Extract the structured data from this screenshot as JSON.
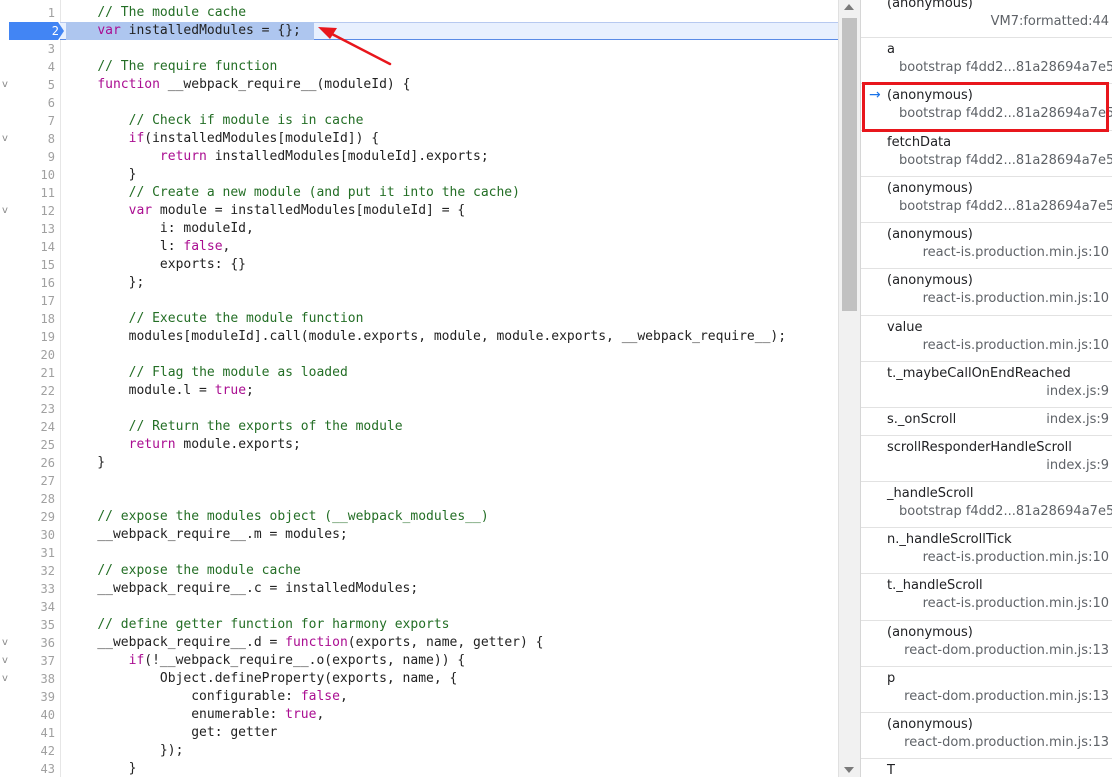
{
  "editor": {
    "current_line": "2",
    "lines": [
      {
        "n": "1",
        "fold": "",
        "segs": [
          [
            "    ",
            ""
          ],
          [
            "// The module cache",
            "c"
          ]
        ]
      },
      {
        "n": "2",
        "fold": "",
        "segs": [
          [
            "    ",
            ""
          ],
          [
            "var",
            "k"
          ],
          [
            " installedModules = {};",
            ""
          ]
        ]
      },
      {
        "n": "3",
        "fold": "",
        "segs": []
      },
      {
        "n": "4",
        "fold": "",
        "segs": [
          [
            "    ",
            ""
          ],
          [
            "// The require function",
            "c"
          ]
        ]
      },
      {
        "n": "5",
        "fold": "v",
        "segs": [
          [
            "    ",
            ""
          ],
          [
            "function",
            "k"
          ],
          [
            " __webpack_require__(moduleId) {",
            ""
          ]
        ]
      },
      {
        "n": "6",
        "fold": "",
        "segs": []
      },
      {
        "n": "7",
        "fold": "",
        "segs": [
          [
            "        ",
            ""
          ],
          [
            "// Check if module is in cache",
            "c"
          ]
        ]
      },
      {
        "n": "8",
        "fold": "v",
        "segs": [
          [
            "        ",
            ""
          ],
          [
            "if",
            "k"
          ],
          [
            "(installedModules[moduleId]) {",
            ""
          ]
        ]
      },
      {
        "n": "9",
        "fold": "",
        "segs": [
          [
            "            ",
            ""
          ],
          [
            "return",
            "k"
          ],
          [
            " installedModules[moduleId].exports;",
            ""
          ]
        ]
      },
      {
        "n": "10",
        "fold": "",
        "segs": [
          [
            "        }",
            ""
          ]
        ]
      },
      {
        "n": "11",
        "fold": "",
        "segs": [
          [
            "        ",
            ""
          ],
          [
            "// Create a new module (and put it into the cache)",
            "c"
          ]
        ]
      },
      {
        "n": "12",
        "fold": "v",
        "segs": [
          [
            "        ",
            ""
          ],
          [
            "var",
            "k"
          ],
          [
            " module = installedModules[moduleId] = {",
            ""
          ]
        ]
      },
      {
        "n": "13",
        "fold": "",
        "segs": [
          [
            "            i: moduleId,",
            ""
          ]
        ]
      },
      {
        "n": "14",
        "fold": "",
        "segs": [
          [
            "            l: ",
            ""
          ],
          [
            "false",
            "k"
          ],
          [
            ",",
            ""
          ]
        ]
      },
      {
        "n": "15",
        "fold": "",
        "segs": [
          [
            "            exports: {}",
            ""
          ]
        ]
      },
      {
        "n": "16",
        "fold": "",
        "segs": [
          [
            "        };",
            ""
          ]
        ]
      },
      {
        "n": "17",
        "fold": "",
        "segs": []
      },
      {
        "n": "18",
        "fold": "",
        "segs": [
          [
            "        ",
            ""
          ],
          [
            "// Execute the module function",
            "c"
          ]
        ]
      },
      {
        "n": "19",
        "fold": "",
        "segs": [
          [
            "        modules[moduleId].call(module.exports, module, module.exports, __webpack_require__);",
            ""
          ]
        ]
      },
      {
        "n": "20",
        "fold": "",
        "segs": []
      },
      {
        "n": "21",
        "fold": "",
        "segs": [
          [
            "        ",
            ""
          ],
          [
            "// Flag the module as loaded",
            "c"
          ]
        ]
      },
      {
        "n": "22",
        "fold": "",
        "segs": [
          [
            "        module.l = ",
            ""
          ],
          [
            "true",
            "k"
          ],
          [
            ";",
            ""
          ]
        ]
      },
      {
        "n": "23",
        "fold": "",
        "segs": []
      },
      {
        "n": "24",
        "fold": "",
        "segs": [
          [
            "        ",
            ""
          ],
          [
            "// Return the exports of the module",
            "c"
          ]
        ]
      },
      {
        "n": "25",
        "fold": "",
        "segs": [
          [
            "        ",
            ""
          ],
          [
            "return",
            "k"
          ],
          [
            " module.exports;",
            ""
          ]
        ]
      },
      {
        "n": "26",
        "fold": "",
        "segs": [
          [
            "    }",
            ""
          ]
        ]
      },
      {
        "n": "27",
        "fold": "",
        "segs": []
      },
      {
        "n": "28",
        "fold": "",
        "segs": []
      },
      {
        "n": "29",
        "fold": "",
        "segs": [
          [
            "    ",
            ""
          ],
          [
            "// expose the modules object (__webpack_modules__)",
            "c"
          ]
        ]
      },
      {
        "n": "30",
        "fold": "",
        "segs": [
          [
            "    __webpack_require__.m = modules;",
            ""
          ]
        ]
      },
      {
        "n": "31",
        "fold": "",
        "segs": []
      },
      {
        "n": "32",
        "fold": "",
        "segs": [
          [
            "    ",
            ""
          ],
          [
            "// expose the module cache",
            "c"
          ]
        ]
      },
      {
        "n": "33",
        "fold": "",
        "segs": [
          [
            "    __webpack_require__.c = installedModules;",
            ""
          ]
        ]
      },
      {
        "n": "34",
        "fold": "",
        "segs": []
      },
      {
        "n": "35",
        "fold": "",
        "segs": [
          [
            "    ",
            ""
          ],
          [
            "// define getter function for harmony exports",
            "c"
          ]
        ]
      },
      {
        "n": "36",
        "fold": "v",
        "segs": [
          [
            "    __webpack_require__.d = ",
            ""
          ],
          [
            "function",
            "k"
          ],
          [
            "(exports, name, getter) {",
            ""
          ]
        ]
      },
      {
        "n": "37",
        "fold": "v",
        "segs": [
          [
            "        ",
            ""
          ],
          [
            "if",
            "k"
          ],
          [
            "(!__webpack_require__.o(exports, name)) {",
            ""
          ]
        ]
      },
      {
        "n": "38",
        "fold": "v",
        "segs": [
          [
            "            Object.defineProperty(exports, name, {",
            ""
          ]
        ]
      },
      {
        "n": "39",
        "fold": "",
        "segs": [
          [
            "                configurable: ",
            ""
          ],
          [
            "false",
            "k"
          ],
          [
            ",",
            ""
          ]
        ]
      },
      {
        "n": "40",
        "fold": "",
        "segs": [
          [
            "                enumerable: ",
            ""
          ],
          [
            "true",
            "k"
          ],
          [
            ",",
            ""
          ]
        ]
      },
      {
        "n": "41",
        "fold": "",
        "segs": [
          [
            "                get: getter",
            ""
          ]
        ]
      },
      {
        "n": "42",
        "fold": "",
        "segs": [
          [
            "            });",
            ""
          ]
        ]
      },
      {
        "n": "43",
        "fold": "",
        "segs": [
          [
            "        }",
            ""
          ]
        ]
      }
    ]
  },
  "call_stack": {
    "frames": [
      {
        "fn": "(anonymous)",
        "loc": "VM7:formatted:44",
        "active": false
      },
      {
        "fn": "a",
        "loc": "bootstrap f4dd2...81a28694a7e5",
        "active": false
      },
      {
        "fn": "(anonymous)",
        "loc": "bootstrap f4dd2...81a28694a7e5",
        "active": true
      },
      {
        "fn": "fetchData",
        "loc": "bootstrap f4dd2...81a28694a7e5",
        "active": false
      },
      {
        "fn": "(anonymous)",
        "loc": "bootstrap f4dd2...81a28694a7e5",
        "active": false
      },
      {
        "fn": "(anonymous)",
        "loc": "react-is.production.min.js:10",
        "active": false
      },
      {
        "fn": "(anonymous)",
        "loc": "react-is.production.min.js:10",
        "active": false
      },
      {
        "fn": "value",
        "loc": "react-is.production.min.js:10",
        "active": false
      },
      {
        "fn": "t._maybeCallOnEndReached",
        "loc": "index.js:9",
        "active": false
      },
      {
        "fn": "s._onScroll",
        "loc": "index.js:9",
        "active": false
      },
      {
        "fn": "scrollResponderHandleScroll",
        "loc": "index.js:9",
        "active": false
      },
      {
        "fn": "_handleScroll",
        "loc": "bootstrap f4dd2...81a28694a7e5",
        "active": false
      },
      {
        "fn": "n._handleScrollTick",
        "loc": "react-is.production.min.js:10",
        "active": false
      },
      {
        "fn": "t._handleScroll",
        "loc": "react-is.production.min.js:10",
        "active": false
      },
      {
        "fn": "(anonymous)",
        "loc": "react-dom.production.min.js:13",
        "active": false
      },
      {
        "fn": "p",
        "loc": "react-dom.production.min.js:13",
        "active": false
      },
      {
        "fn": "(anonymous)",
        "loc": "react-dom.production.min.js:13",
        "active": false
      },
      {
        "fn": "T",
        "loc": "",
        "active": false
      }
    ]
  },
  "icons": {
    "active_frame": "arrow-right-icon",
    "fold": "chevron-down-icon"
  },
  "colors": {
    "comment": "#236e25",
    "keyword": "#aa0d91",
    "exec_highlight": "#aec6ef",
    "breakpoint": "#4285f4",
    "annotation": "#e8161c",
    "active_arrow": "#1a73e8"
  }
}
